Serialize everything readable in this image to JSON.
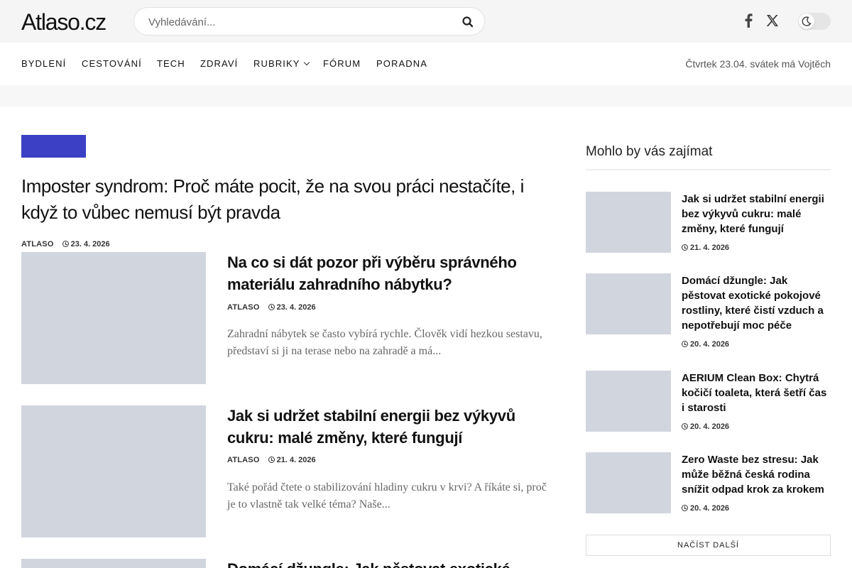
{
  "header": {
    "logo": "Atlaso.cz",
    "search_placeholder": "Vyhledávání...",
    "icons": [
      "search-icon",
      "facebook-icon",
      "x-twitter-icon",
      "moon-icon"
    ]
  },
  "nav": {
    "items": [
      {
        "label": "BYDLENÍ"
      },
      {
        "label": "CESTOVÁNÍ"
      },
      {
        "label": "TECH"
      },
      {
        "label": "ZDRAVÍ"
      },
      {
        "label": "RUBRIKY"
      },
      {
        "label": "FÓRUM"
      },
      {
        "label": "PORADNA"
      }
    ],
    "date_text": "Čtvrtek 23.04. svátek má Vojtěch"
  },
  "colors": {
    "accent": "#3b40c4",
    "thumb_placeholder": "#d1d5de",
    "header_bg": "#f5f5f5"
  },
  "hero": {
    "title": "Imposter syndrom: Proč máte pocit, že na svou práci nestačíte, i když to vůbec nemusí být pravda",
    "author": "ATLASO",
    "date": "23. 4. 2026"
  },
  "posts": [
    {
      "title": "Na co si dát pozor při výběru správného materiálu zahradního nábytku?",
      "author": "ATLASO",
      "date": "23. 4. 2026",
      "excerpt": "Zahradní nábytek se často vybírá rychle. Člověk vidí hezkou sestavu, představí si ji na terase nebo na zahradě a má..."
    },
    {
      "title": "Jak si udržet stabilní energii bez výkyvů cukru: malé změny, které fungují",
      "author": "ATLASO",
      "date": "21. 4. 2026",
      "excerpt": "Také pořád čtete o stabilizování hladiny cukru v krvi? A říkáte si, proč je to vlastně tak velké téma? Naše..."
    },
    {
      "title": "Domácí džungle: Jak pěstovat exotické"
    }
  ],
  "sidebar": {
    "heading": "Mohlo by vás zajímat",
    "items": [
      {
        "title": "Jak si udržet stabilní energii bez výkyvů cukru: malé změny, které fungují",
        "date": "21. 4. 2026"
      },
      {
        "title": "Domácí džungle: Jak pěstovat exotické pokojové rostliny, které čistí vzduch a nepotřebují moc péče",
        "date": "20. 4. 2026"
      },
      {
        "title": "AERIUM Clean Box: Chytrá kočičí toaleta, která šetří čas i starosti",
        "date": "20. 4. 2026"
      },
      {
        "title": "Zero Waste bez stresu: Jak může běžná česká rodina snížit odpad krok za krokem",
        "date": "20. 4. 2026"
      }
    ],
    "load_more": "NAČÍST DALŠÍ"
  }
}
